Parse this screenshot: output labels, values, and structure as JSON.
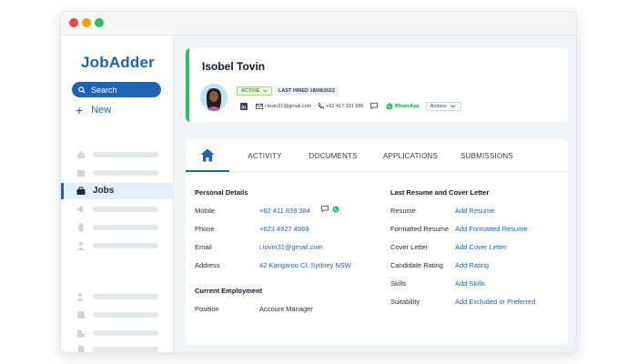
{
  "app": {
    "logo": "JobAdder"
  },
  "sidebar": {
    "search_label": "Search",
    "new_label": "New",
    "active_item": "Jobs"
  },
  "profile": {
    "name": "Isobel Tovin",
    "status": "ACTIVE",
    "last_hired": "LAST HIRED 18/08/2022",
    "email": "i.tovin31@gmail.com",
    "phone": "+61 417 331 986",
    "whatsapp": "WhatsApp",
    "actions": "Actions"
  },
  "tabs": [
    {
      "label": ""
    },
    {
      "label": "ACTIVITY"
    },
    {
      "label": "DOCUMENTS"
    },
    {
      "label": "APPLICATIONS"
    },
    {
      "label": "SUBMISSIONS"
    }
  ],
  "personal": {
    "title": "Personal Details",
    "fields": [
      {
        "label": "Mobile",
        "value": "+62 411 839 384"
      },
      {
        "label": "Phone",
        "value": "+623 4927 4969"
      },
      {
        "label": "Email",
        "value": "i.tovin31@gmail.com"
      },
      {
        "label": "Address",
        "value": "42 Kangaroo Cl. Sydney NSW"
      }
    ]
  },
  "employment": {
    "title": "Current Employment",
    "fields": [
      {
        "label": "Position",
        "value": "Account Manager"
      }
    ]
  },
  "resume": {
    "title": "Last Resume and Cover Letter",
    "fields": [
      {
        "label": "Resume",
        "value": "Add Resume"
      },
      {
        "label": "Formatted Resume",
        "value": "Add Formatted Resume"
      },
      {
        "label": "Cover Letter",
        "value": "Add Cover Letter"
      },
      {
        "label": "Candidate Rating",
        "value": "Add Rating"
      },
      {
        "label": "Skills",
        "value": "Add Skills"
      },
      {
        "label": "Suitability",
        "value": "Add Excluded or Preferred"
      }
    ]
  },
  "colors": {
    "brand": "#1e63b5",
    "active_green": "#22c55e",
    "whatsapp": "#16a34a"
  }
}
